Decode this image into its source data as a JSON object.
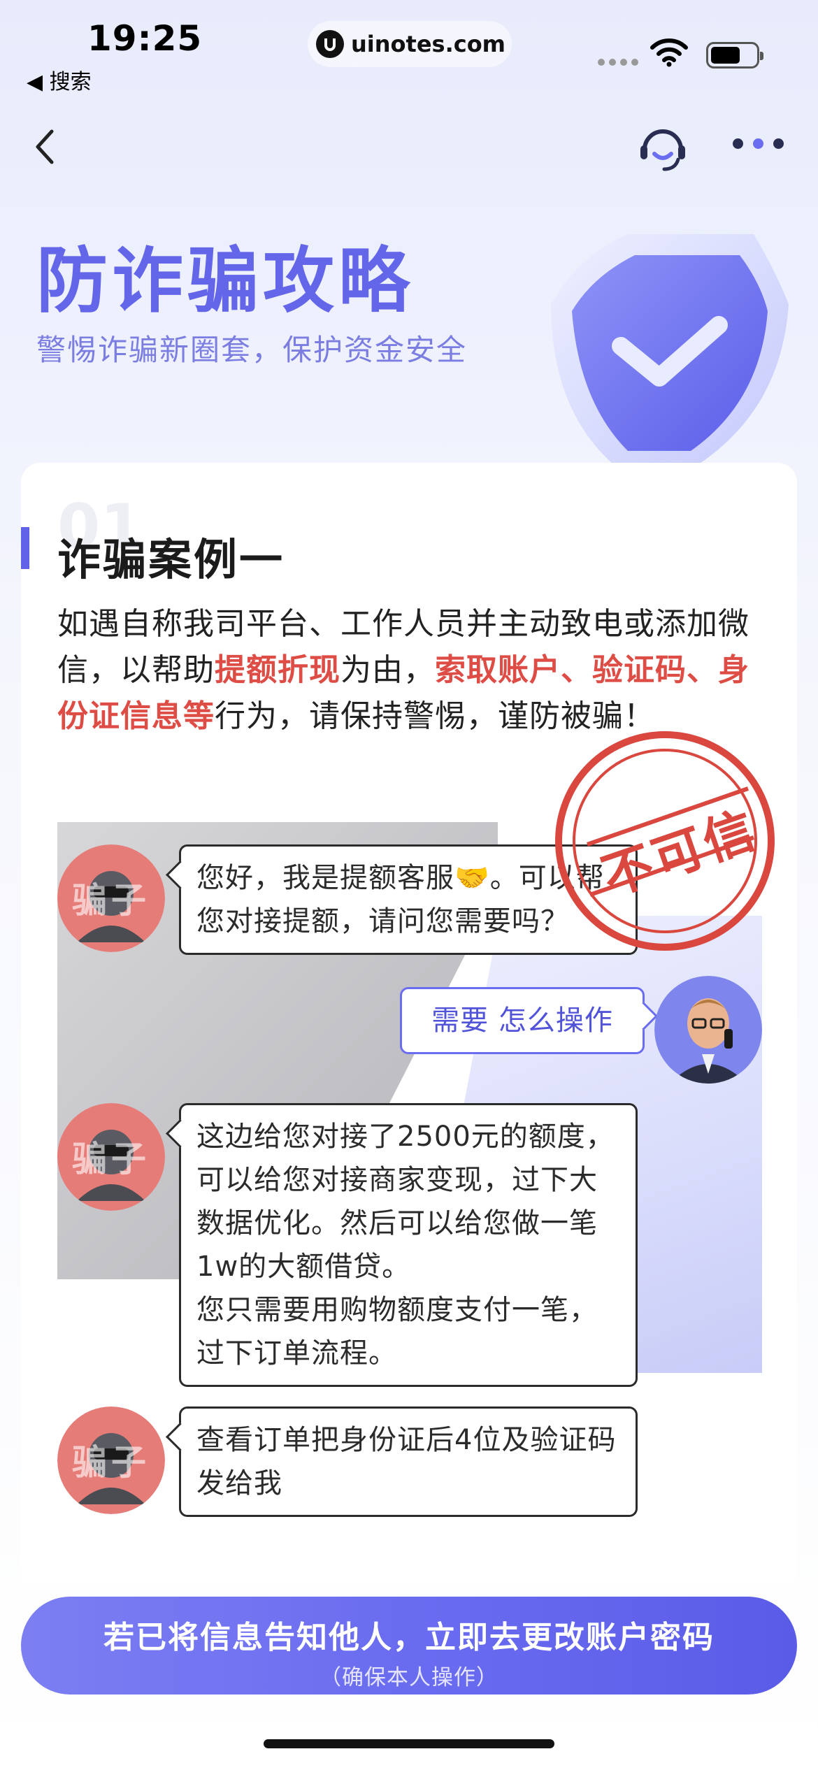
{
  "status_bar": {
    "time": "19:25",
    "back_app": "◀ 搜索",
    "url": "uinotes.com"
  },
  "hero": {
    "title": "防诈骗攻略",
    "subtitle": "警惕诈骗新圈套，保护资金安全"
  },
  "case": {
    "number": "01",
    "title": "诈骗案例一",
    "desc": [
      {
        "text": "如遇自称我司平台、工作人员并主动致电或添加微信，以帮助",
        "highlight": false
      },
      {
        "text": "提额折现",
        "highlight": true
      },
      {
        "text": "为由，",
        "highlight": false
      },
      {
        "text": "索取账户、验证码、身份证信息等",
        "highlight": true
      },
      {
        "text": "行为，请保持警惕，谨防被骗！",
        "highlight": false
      }
    ]
  },
  "stamp_text": "不可信",
  "scammer_label": "骗子",
  "chat": {
    "msg1": "您好，我是提额客服🤝。可以帮您对接提额，请问您需要吗？",
    "reply1": "需要 怎么操作",
    "msg2_line1": "这边给您对接了2500元的额度，可以给您对接商家变现，过下大数据优化。然后可以给您做一笔1w的大额借贷。",
    "msg2_line2": "您只需要用购物额度支付一笔，过下订单流程。",
    "msg3": "查看订单把身份证后4位及验证码发给我"
  },
  "cta": {
    "main": "若已将信息告知他人，立即去更改账户密码",
    "sub": "（确保本人操作）"
  },
  "colors": {
    "accent": "#6466ea",
    "highlight": "#de4d45",
    "stamp": "#d9473f"
  }
}
